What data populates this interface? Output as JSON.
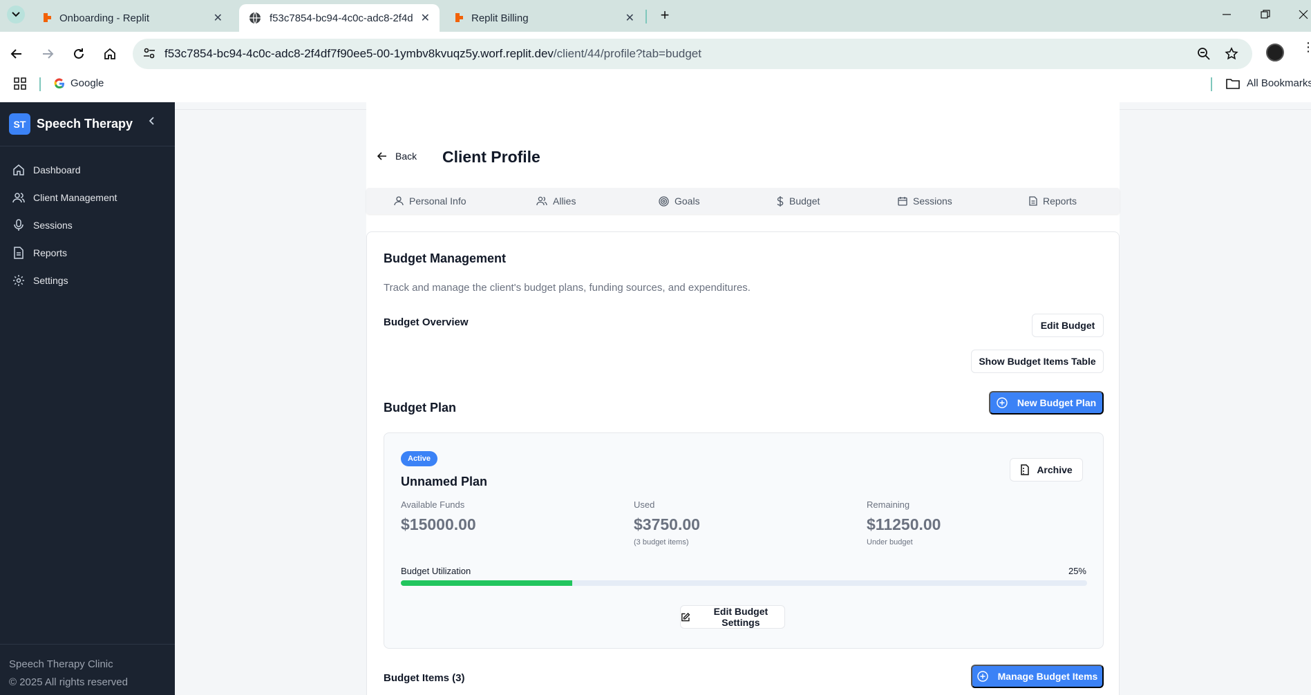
{
  "browser": {
    "tabs": [
      {
        "title": "Onboarding - Replit",
        "icon": "replit-icon",
        "active": false
      },
      {
        "title": "f53c7854-bc94-4c0c-adc8-2f4d",
        "icon": "globe-icon",
        "active": true
      },
      {
        "title": "Replit Billing",
        "icon": "replit-icon",
        "active": false
      }
    ],
    "close_glyph": "✕",
    "new_tab_glyph": "+",
    "url_host": "f53c7854-bc94-4c0c-adc8-2f4df7f90ee5-00-1ymbv8kvuqz5y.worf.replit.dev",
    "url_path": "/client/44/profile?tab=budget",
    "bookmarks": {
      "google": "Google",
      "all": "All Bookmarks"
    }
  },
  "sidebar": {
    "logo_text": "ST",
    "brand": "Speech Therapy",
    "items": [
      {
        "label": "Dashboard",
        "icon": "home-icon"
      },
      {
        "label": "Client Management",
        "icon": "users-icon"
      },
      {
        "label": "Sessions",
        "icon": "mic-icon"
      },
      {
        "label": "Reports",
        "icon": "file-icon"
      },
      {
        "label": "Settings",
        "icon": "gear-icon"
      }
    ],
    "footer_line1": "Speech Therapy Clinic",
    "footer_line2": "© 2025 All rights reserved"
  },
  "header": {
    "back_label": "Back",
    "title": "Client Profile"
  },
  "profile_tabs": [
    {
      "label": "Personal Info",
      "icon": "user-icon"
    },
    {
      "label": "Allies",
      "icon": "users-icon"
    },
    {
      "label": "Goals",
      "icon": "target-icon"
    },
    {
      "label": "Budget",
      "icon": "dollar-icon"
    },
    {
      "label": "Sessions",
      "icon": "calendar-icon"
    },
    {
      "label": "Reports",
      "icon": "file-icon"
    }
  ],
  "budget": {
    "title": "Budget Management",
    "description": "Track and manage the client's budget plans, funding sources, and expenditures.",
    "overview_heading": "Budget Overview",
    "edit_budget_label": "Edit Budget",
    "show_table_label": "Show Budget Items Table",
    "plan_heading": "Budget Plan",
    "new_plan_label": "New Budget Plan",
    "plan": {
      "status": "Active",
      "name": "Unnamed Plan",
      "archive_label": "Archive",
      "available_label": "Available Funds",
      "available_value": "$15000.00",
      "used_label": "Used",
      "used_value": "$3750.00",
      "used_sub": "(3 budget items)",
      "remaining_label": "Remaining",
      "remaining_value": "$11250.00",
      "remaining_sub": "Under budget",
      "utilization_label": "Budget Utilization",
      "utilization_pct_text": "25%",
      "utilization_fraction": 0.25,
      "edit_settings_label": "Edit Budget Settings"
    },
    "items_heading": "Budget Items (3)",
    "manage_items_label": "Manage Budget Items"
  },
  "colors": {
    "accent": "#3b82f6",
    "progress": "#22c55e",
    "sidebar_bg": "#1b2330"
  }
}
